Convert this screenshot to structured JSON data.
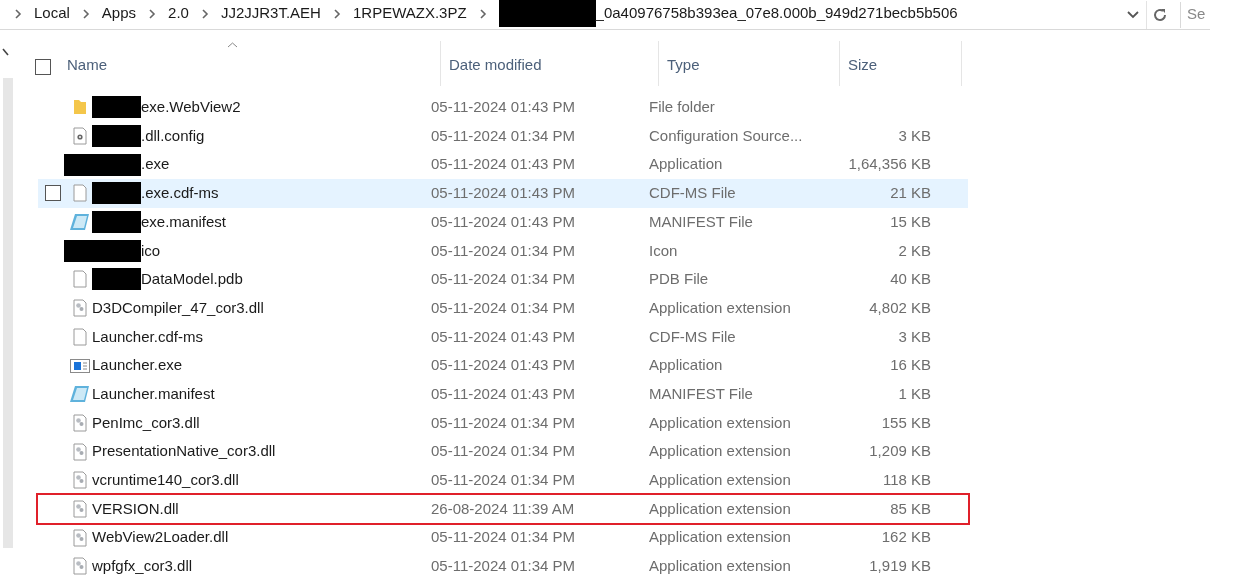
{
  "address_bar": {
    "path": [
      {
        "label": "Local",
        "redacted": false
      },
      {
        "label": "Apps",
        "redacted": false
      },
      {
        "label": "2.0",
        "redacted": false
      },
      {
        "label": "JJ2JJR3T.AEH",
        "redacted": false
      },
      {
        "label": "1RPEWAZX.3PZ",
        "redacted": false
      },
      {
        "label": "_0a40976758b393ea_07e8.000b_949d271becb5b506",
        "redacted": true
      }
    ]
  },
  "search": {
    "placeholder": "Se"
  },
  "select_all": {
    "checked": false
  },
  "table": {
    "columns": [
      "Name",
      "Date modified",
      "Type",
      "Size"
    ],
    "rows": [
      {
        "kind": "folder",
        "redacted": true,
        "name": "exe.WebView2",
        "date": "05-11-2024 01:43 PM",
        "type": "File folder",
        "size": "",
        "hovered": false,
        "highlighted": false
      },
      {
        "kind": "config",
        "redacted": true,
        "name": ".dll.config",
        "date": "05-11-2024 01:34 PM",
        "type": "Configuration Source...",
        "size": "3 KB",
        "hovered": false,
        "highlighted": false
      },
      {
        "kind": "none",
        "redacted": true,
        "name": ".exe",
        "date": "05-11-2024 01:43 PM",
        "type": "Application",
        "size": "1,64,356 KB",
        "hovered": false,
        "highlighted": false
      },
      {
        "kind": "file",
        "redacted": true,
        "name": ".exe.cdf-ms",
        "date": "05-11-2024 01:43 PM",
        "type": "CDF-MS File",
        "size": "21 KB",
        "hovered": true,
        "highlighted": false
      },
      {
        "kind": "manifest",
        "redacted": true,
        "name": "exe.manifest",
        "date": "05-11-2024 01:43 PM",
        "type": "MANIFEST File",
        "size": "15 KB",
        "hovered": false,
        "highlighted": false
      },
      {
        "kind": "none",
        "redacted": true,
        "name": "ico",
        "date": "05-11-2024 01:34 PM",
        "type": "Icon",
        "size": "2 KB",
        "hovered": false,
        "highlighted": false
      },
      {
        "kind": "file",
        "redacted": true,
        "name": "DataModel.pdb",
        "date": "05-11-2024 01:34 PM",
        "type": "PDB File",
        "size": "40 KB",
        "hovered": false,
        "highlighted": false
      },
      {
        "kind": "dll",
        "redacted": false,
        "name": "D3DCompiler_47_cor3.dll",
        "date": "05-11-2024 01:34 PM",
        "type": "Application extension",
        "size": "4,802 KB",
        "hovered": false,
        "highlighted": false
      },
      {
        "kind": "file",
        "redacted": false,
        "name": "Launcher.cdf-ms",
        "date": "05-11-2024 01:43 PM",
        "type": "CDF-MS File",
        "size": "3 KB",
        "hovered": false,
        "highlighted": false
      },
      {
        "kind": "exe",
        "redacted": false,
        "name": "Launcher.exe",
        "date": "05-11-2024 01:43 PM",
        "type": "Application",
        "size": "16 KB",
        "hovered": false,
        "highlighted": false
      },
      {
        "kind": "manifest",
        "redacted": false,
        "name": "Launcher.manifest",
        "date": "05-11-2024 01:43 PM",
        "type": "MANIFEST File",
        "size": "1 KB",
        "hovered": false,
        "highlighted": false
      },
      {
        "kind": "dll",
        "redacted": false,
        "name": "PenImc_cor3.dll",
        "date": "05-11-2024 01:34 PM",
        "type": "Application extension",
        "size": "155 KB",
        "hovered": false,
        "highlighted": false
      },
      {
        "kind": "dll",
        "redacted": false,
        "name": "PresentationNative_cor3.dll",
        "date": "05-11-2024 01:34 PM",
        "type": "Application extension",
        "size": "1,209 KB",
        "hovered": false,
        "highlighted": false
      },
      {
        "kind": "dll",
        "redacted": false,
        "name": "vcruntime140_cor3.dll",
        "date": "05-11-2024 01:34 PM",
        "type": "Application extension",
        "size": "118 KB",
        "hovered": false,
        "highlighted": false
      },
      {
        "kind": "dll",
        "redacted": false,
        "name": "VERSION.dll",
        "date": "26-08-2024 11:39 AM",
        "type": "Application extension",
        "size": "85 KB",
        "hovered": false,
        "highlighted": true
      },
      {
        "kind": "dll",
        "redacted": false,
        "name": "WebView2Loader.dll",
        "date": "05-11-2024 01:34 PM",
        "type": "Application extension",
        "size": "162 KB",
        "hovered": false,
        "highlighted": false
      },
      {
        "kind": "dll",
        "redacted": false,
        "name": "wpfgfx_cor3.dll",
        "date": "05-11-2024 01:34 PM",
        "type": "Application extension",
        "size": "1,919 KB",
        "hovered": false,
        "highlighted": false
      }
    ]
  }
}
